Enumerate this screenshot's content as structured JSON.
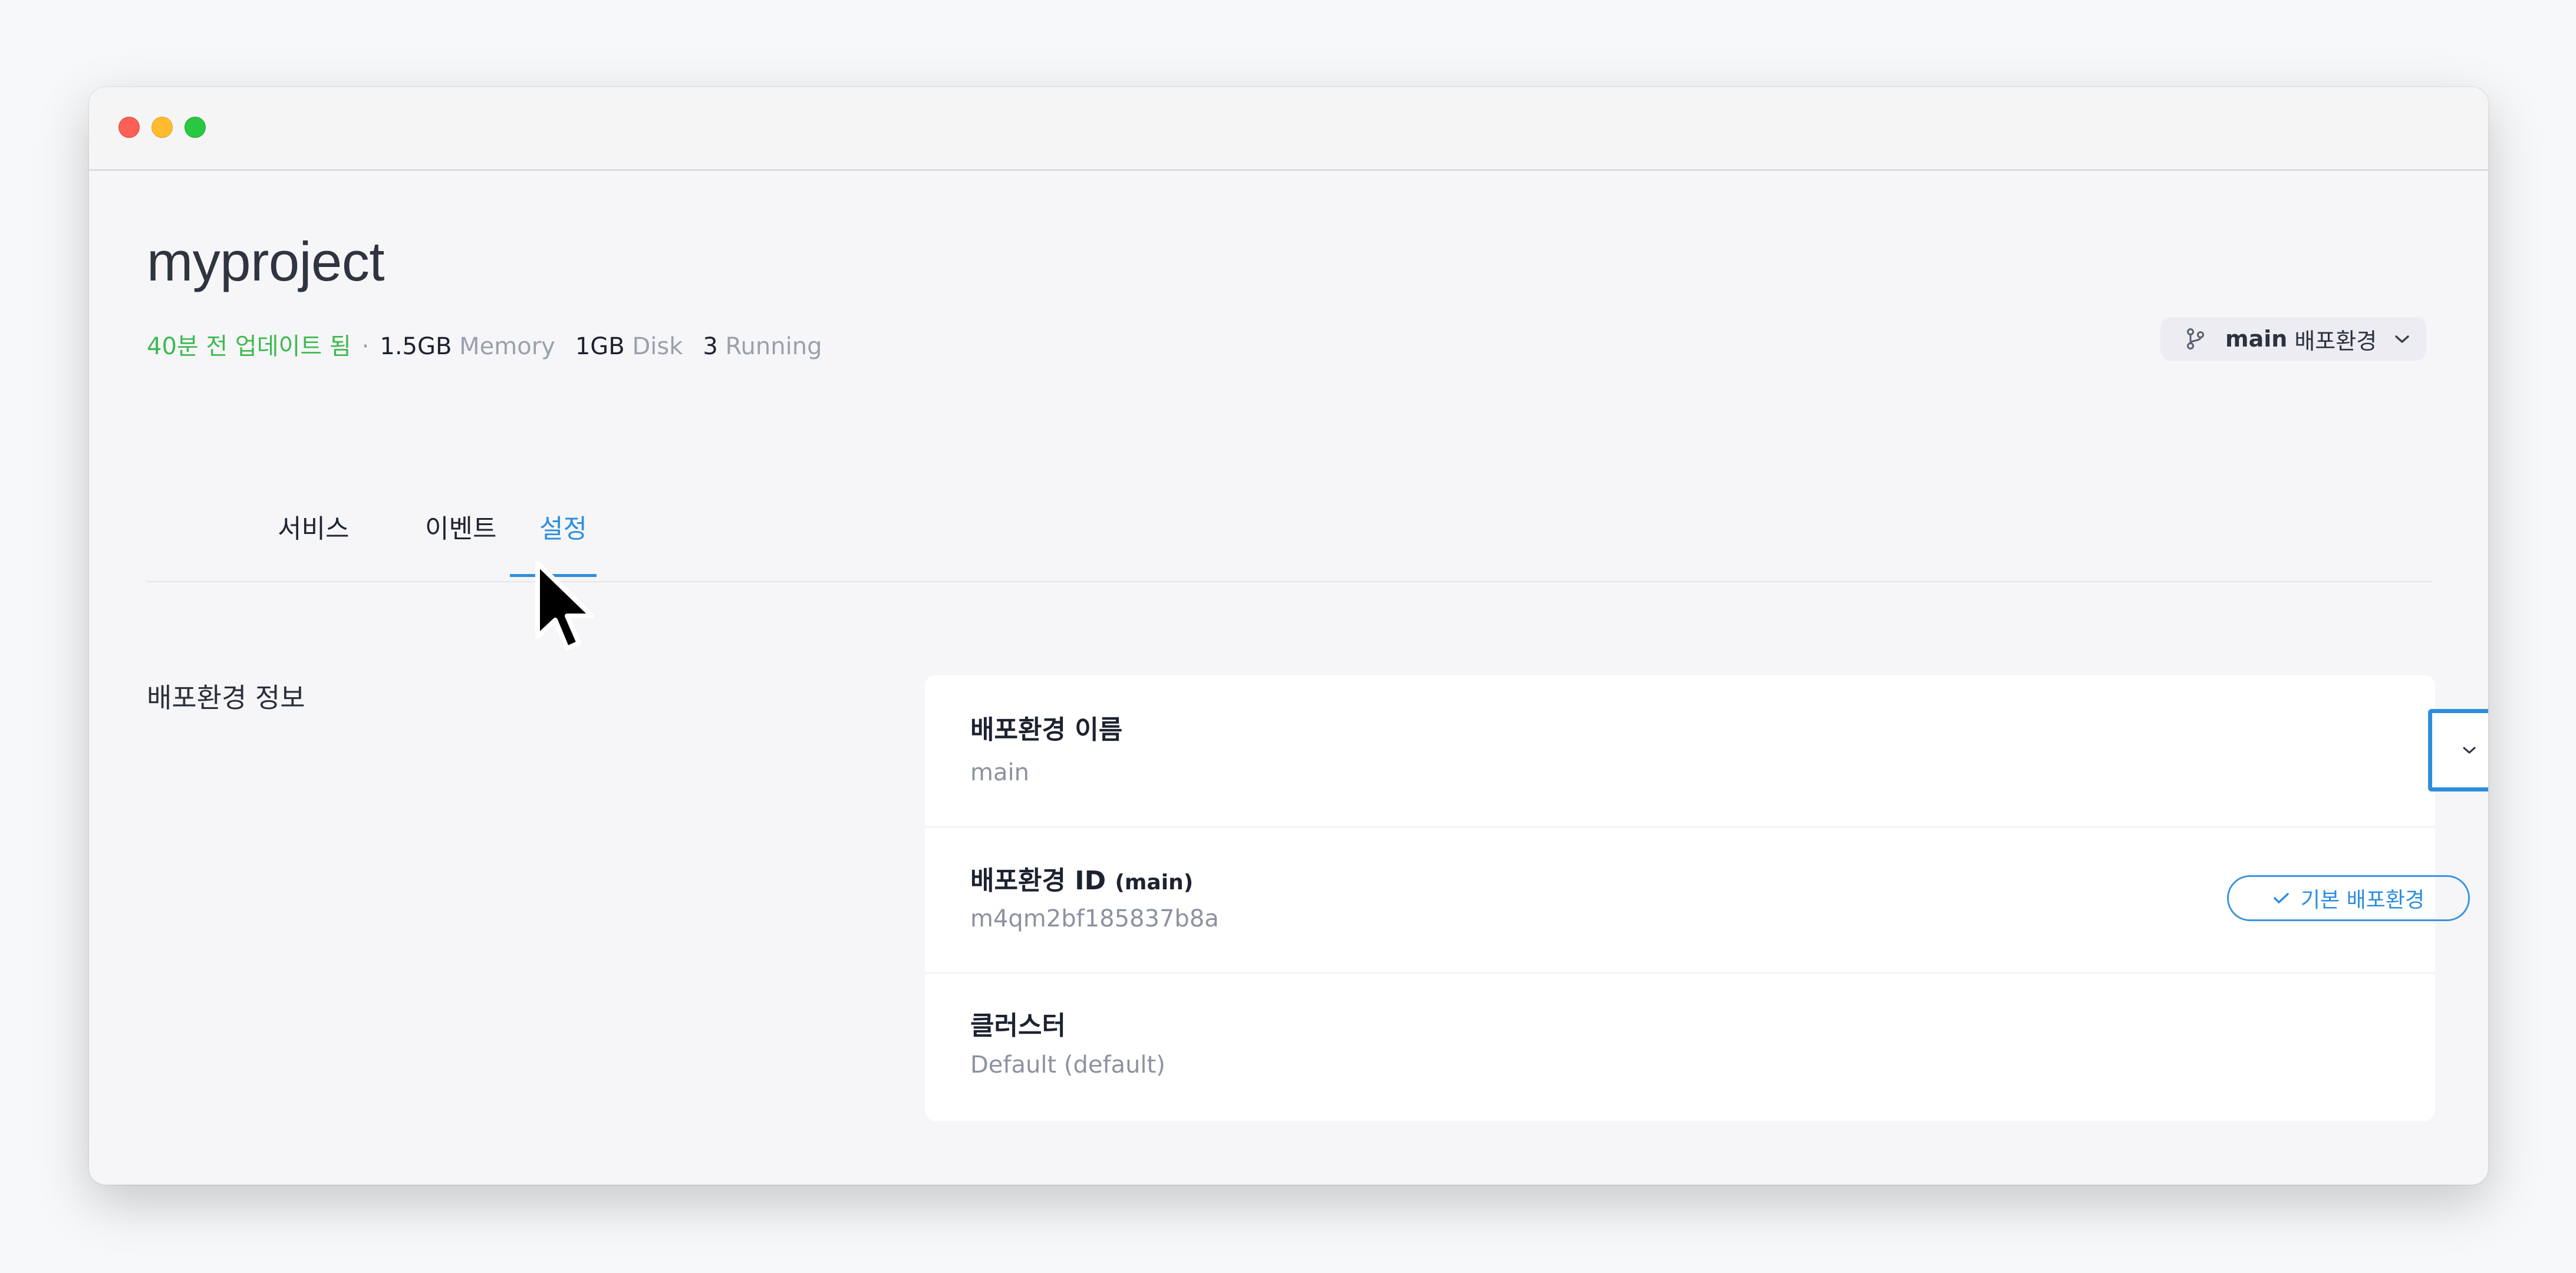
{
  "project": {
    "title": "myproject",
    "updated": "40분 전 업데이트 됨",
    "separator": "·",
    "memory_value": "1.5GB",
    "memory_label": "Memory",
    "disk_value": "1GB",
    "disk_label": "Disk",
    "running_value": "3",
    "running_label": "Running"
  },
  "env_selector": {
    "branch_name": "main",
    "label": "배포환경",
    "icons": [
      "branch-icon",
      "chevron-down-icon"
    ]
  },
  "tabs": [
    {
      "label": "서비스",
      "active": false
    },
    {
      "label": "이벤트",
      "active": false
    },
    {
      "label": "설정",
      "active": true
    }
  ],
  "section": {
    "label": "배포환경 정보"
  },
  "card": {
    "rows": [
      {
        "title": "배포환경 이름",
        "value": "main"
      },
      {
        "title": "배포환경 ID",
        "title_suffix": "(main)",
        "value": "m4qm2bf185837b8a"
      },
      {
        "title": "클러스터",
        "value": "Default (default)"
      }
    ],
    "default_badge": "기본 배포환경"
  },
  "colors": {
    "accent": "#2f8fdc",
    "updated_green": "#3fb950",
    "muted": "#9aa0ad"
  }
}
